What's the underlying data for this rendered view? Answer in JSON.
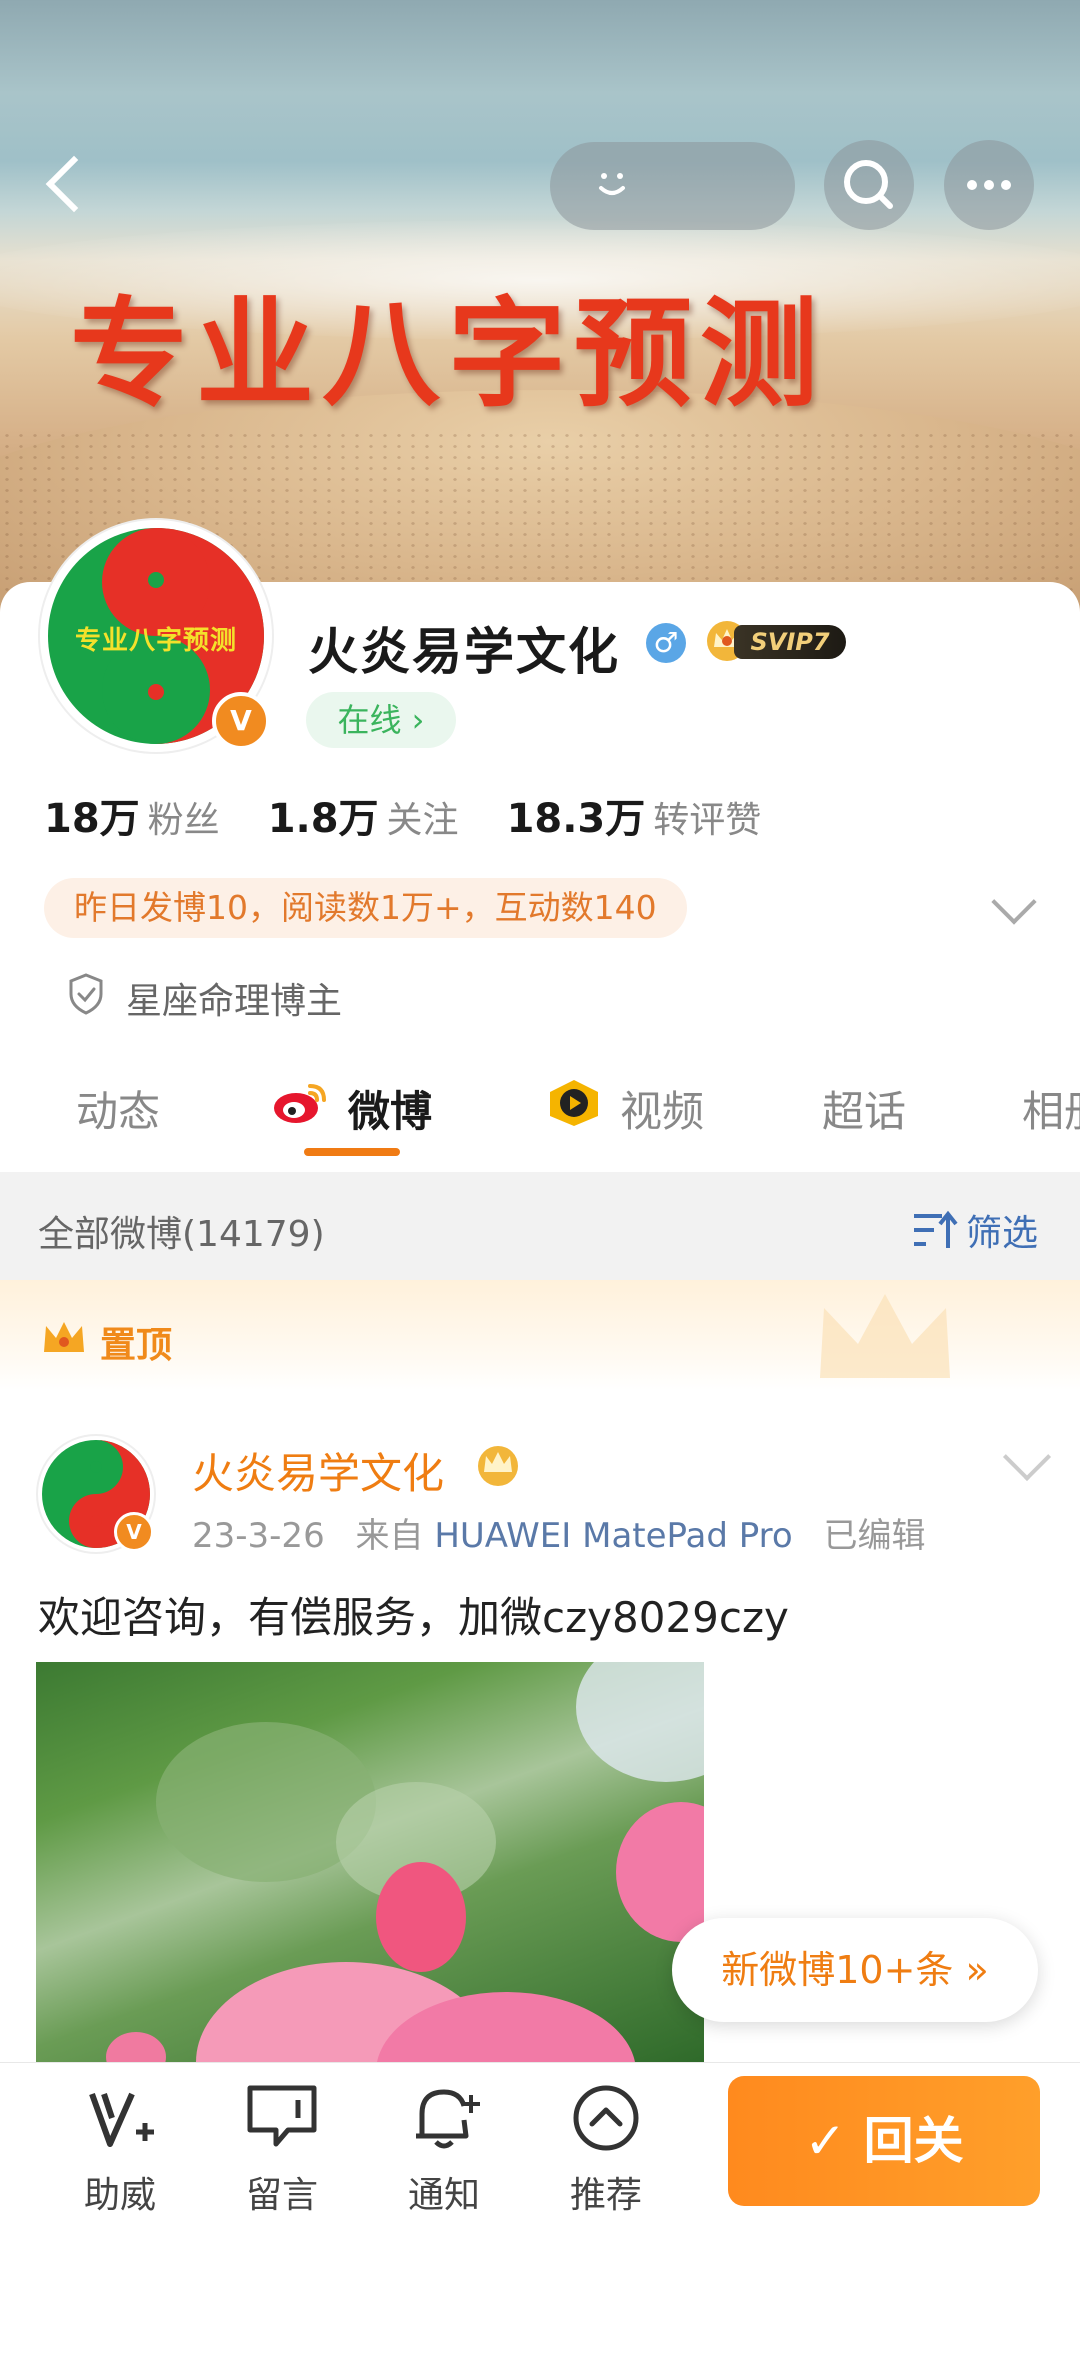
{
  "banner": {
    "title": "专业八字预测"
  },
  "profile": {
    "name": "火炎易学文化",
    "vip_label": "SVIP7",
    "online_label": "在线 ›",
    "avatar_text": "专业八字预测",
    "verified_badge": "V",
    "stats": [
      {
        "value": "18万",
        "label": "粉丝"
      },
      {
        "value": "1.8万",
        "label": "关注"
      },
      {
        "value": "18.3万",
        "label": "转评赞"
      }
    ],
    "activity_summary": "昨日发博10，阅读数1万+，互动数140",
    "tag": "星座命理博主"
  },
  "tabs": [
    {
      "label": "动态",
      "active": false
    },
    {
      "label": "微博",
      "active": true
    },
    {
      "label": "视频",
      "active": false
    },
    {
      "label": "超话",
      "active": false
    },
    {
      "label": "相册",
      "active": false
    }
  ],
  "filter": {
    "count_label": "全部微博(14179)",
    "filter_label": "筛选"
  },
  "pinned": {
    "label": "置顶"
  },
  "post": {
    "author": "火炎易学文化",
    "date": "23-3-26",
    "source_prefix": "来自",
    "device": "HUAWEI MatePad Pro",
    "edited": "已编辑",
    "text": "欢迎咨询，有偿服务，加微czy8029czy"
  },
  "new_posts_label": "新微博10+条 »",
  "bottom_bar": {
    "items": [
      {
        "label": "助威",
        "icon": "v-plus-icon"
      },
      {
        "label": "留言",
        "icon": "message-icon"
      },
      {
        "label": "通知",
        "icon": "bell-plus-icon"
      },
      {
        "label": "推荐",
        "icon": "chevron-up-circle-icon"
      }
    ],
    "follow_label": "✓ 回关"
  },
  "colors": {
    "accent": "#ef7d12",
    "online_green": "#3bb45d",
    "link_blue": "#3f6fb5"
  }
}
